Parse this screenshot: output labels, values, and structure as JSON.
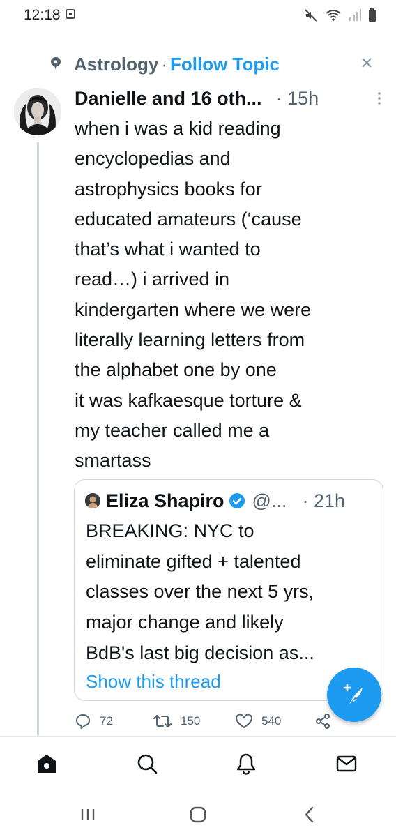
{
  "status_bar": {
    "time": "12:18",
    "icons": [
      "app-notification-icon",
      "mute-icon",
      "wifi-icon",
      "signal-icon",
      "battery-icon"
    ]
  },
  "topic": {
    "icon": "topic-bubble-icon",
    "name": "Astrology",
    "separator": "·",
    "follow_label": "Follow Topic",
    "close_icon": "close-icon"
  },
  "tweet": {
    "author": "Danielle and 16 oth...",
    "time": "· 15h",
    "more_icon": "more-vertical-icon",
    "body_lines": [
      "when i was a kid reading",
      "encyclopedias and",
      "astrophysics books for",
      "educated amateurs (‘cause",
      "that’s what i wanted to",
      "read…) i arrived in",
      "kindergarten where we were",
      "literally learning letters from",
      "the alphabet one by one",
      "it was kafkaesque torture &",
      "my teacher called me a",
      "smartass"
    ],
    "quote": {
      "name": "Eliza Shapiro",
      "handle": "@...",
      "time": "· 21h",
      "verified": true,
      "body_lines": [
        "BREAKING: NYC to",
        "eliminate gifted + talented",
        "classes over the next 5 yrs,",
        "major change and likely",
        "BdB's last big decision as..."
      ],
      "show_thread": "Show this thread"
    },
    "actions": {
      "replies": "72",
      "retweets": "150",
      "likes": "540"
    }
  },
  "fab": {
    "icon": "compose-tweet-icon"
  },
  "bottom_nav": [
    "home-icon",
    "search-icon",
    "notifications-icon",
    "messages-icon"
  ],
  "android_nav": [
    "recent-apps-icon",
    "home-circle-icon",
    "back-icon"
  ],
  "colors": {
    "accent": "#1d9bf0",
    "secondary_text": "#536471",
    "text": "#0f1419",
    "border": "#cfd9de"
  }
}
